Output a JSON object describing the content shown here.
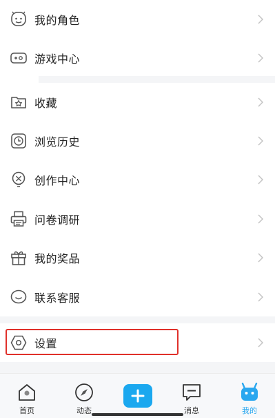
{
  "menu": {
    "items": [
      {
        "label": "我的角色",
        "icon": "character-face-icon"
      },
      {
        "label": "游戏中心",
        "icon": "gamepad-icon"
      },
      {
        "label": "收藏",
        "icon": "folder-star-icon"
      },
      {
        "label": "浏览历史",
        "icon": "clock-icon"
      },
      {
        "label": "创作中心",
        "icon": "creator-bulb-icon"
      },
      {
        "label": "问卷调研",
        "icon": "survey-printer-icon"
      },
      {
        "label": "我的奖品",
        "icon": "gift-box-icon"
      },
      {
        "label": "联系客服",
        "icon": "chat-smile-icon"
      },
      {
        "label": "设置",
        "icon": "hexagon-gear-icon"
      }
    ]
  },
  "tabbar": {
    "tabs": [
      {
        "label": "首页",
        "icon": "home-icon"
      },
      {
        "label": "动态",
        "icon": "compass-icon"
      },
      {
        "label": "",
        "icon": "plus-icon"
      },
      {
        "label": "消息",
        "icon": "message-icon"
      },
      {
        "label": "我的",
        "icon": "mascot-icon",
        "active": true
      }
    ]
  },
  "colors": {
    "accent": "#1ba8ef",
    "active_tab": "#2aa7ef",
    "highlight_border": "#e0302a",
    "separator": "#f4f5f7"
  }
}
